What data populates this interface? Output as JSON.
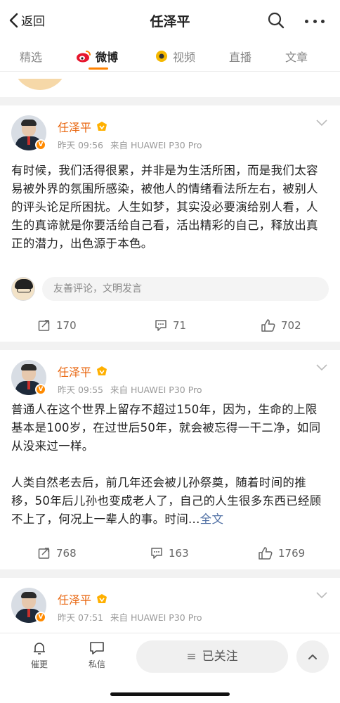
{
  "nav": {
    "back_label": "返回",
    "title": "任泽平"
  },
  "tabs": [
    {
      "label": "精选"
    },
    {
      "label": "微博"
    },
    {
      "label": "视频"
    },
    {
      "label": "直播"
    },
    {
      "label": "文章"
    }
  ],
  "posts": [
    {
      "author": "任泽平",
      "time": "昨天 09:56",
      "source": "来自 HUAWEI P30 Pro",
      "paragraphs": [
        "有时候，我们活得很累，并非是为生活所困，而是我们太容易被外界的氛围所感染，被他人的情绪看法所左右，被别人的评头论足所困扰。人生如梦，其实没必要演给别人看，人生的真谛就是你要活给自己看，活出精彩的自己，释放出真正的潜力，出色源于本色。"
      ],
      "comment_placeholder": "友善评论，文明发言",
      "reposts": "170",
      "comments": "71",
      "likes": "702"
    },
    {
      "author": "任泽平",
      "time": "昨天 09:55",
      "source": "来自 HUAWEI P30 Pro",
      "paragraphs": [
        "普通人在这个世界上留存不超过150年，因为，生命的上限基本是100岁，在过世后50年，就会被忘得一干二净，如同从没来过一样。",
        "人类自然老去后，前几年还会被儿孙祭奠，随着时间的推移，50年后儿孙也变成老人了，自己的人生很多东西已经顾不上了，何况上一辈人的事。时间..."
      ],
      "more_label": "全文",
      "reposts": "768",
      "comments": "163",
      "likes": "1769"
    },
    {
      "author": "任泽平",
      "time": "昨天 07:51",
      "source": "来自 HUAWEI P30 Pro"
    }
  ],
  "bottom": {
    "refresh_label": "催更",
    "message_label": "私信",
    "follow_label": "已关注"
  },
  "colors": {
    "accent": "#ff8200",
    "username": "#e8640c",
    "link": "#4e6ea3"
  }
}
